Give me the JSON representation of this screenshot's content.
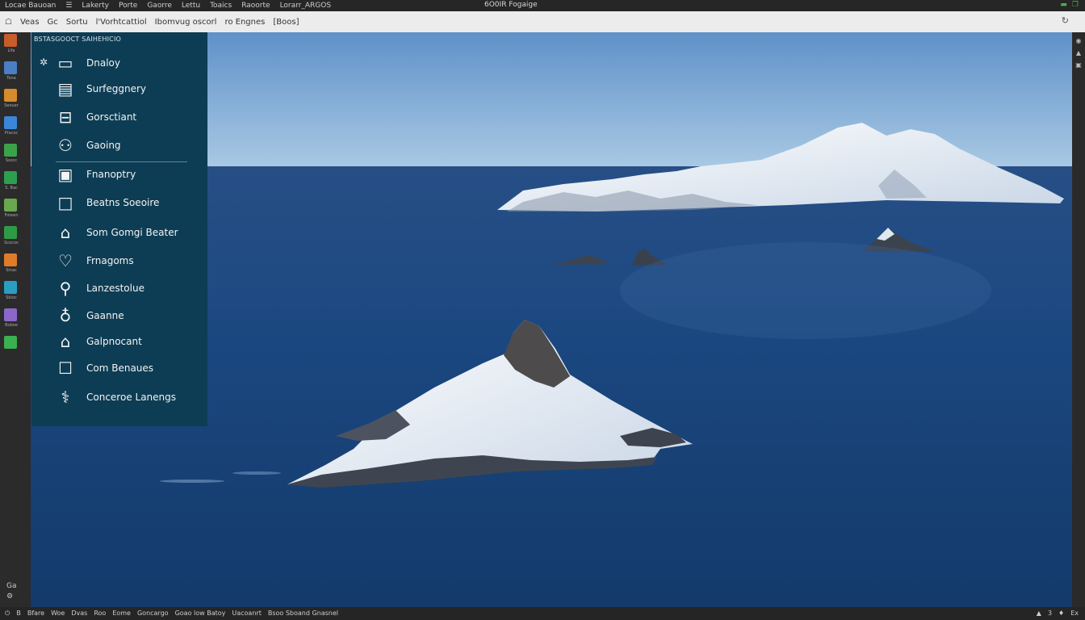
{
  "topbar": {
    "menu": [
      "Locae Bauoan",
      "☰",
      "Lakerty",
      "Porte",
      "Gaorre",
      "Lettu",
      "Toaics",
      "Raoorte",
      "Lorarr_ARGOS"
    ],
    "title": "6O0IR Fogaige",
    "right_icons": [
      "minimize-icon",
      "restore-icon"
    ]
  },
  "toolbar": {
    "items": [
      "☖",
      "Veas",
      "Gc",
      "Sortu",
      "l'Vorhtcattiol",
      "Ibomvug oscorl",
      "ro Engnes",
      "[Boos]"
    ],
    "right_icon": "refresh-icon"
  },
  "dock": {
    "labels": [
      "Lifa",
      "Tona",
      "Seouer",
      "Pracsc",
      "Ssocc",
      "S. Bac",
      "Foteen",
      "Scocov",
      "Sinac",
      "Sbioc",
      "Boboe"
    ],
    "colors": [
      "#c85c2a",
      "#4a7fc4",
      "#d68b2d",
      "#3a86d8",
      "#3aa34a",
      "#2e9e4f",
      "#6aa84f",
      "#2f9a46",
      "#e07b2a",
      "#2a9ec0",
      "#8c67c9",
      "#3ab04f"
    ],
    "bottom": [
      "Ga",
      "⚙"
    ]
  },
  "panel": {
    "title": "BSTASGOOCT SAIHEHICIO",
    "items": [
      {
        "label": "Dnaloy",
        "icon": "chat-bubble-icon"
      },
      {
        "label": "Surfeggnery",
        "icon": "document-stack-icon"
      },
      {
        "label": "Gorsctiant",
        "icon": "monitor-doc-icon"
      },
      {
        "label": "Gaoing",
        "icon": "gamepad-icon"
      },
      {
        "label": "Fnanoptry",
        "icon": "desktop-icon"
      },
      {
        "label": "Beatns Soeoire",
        "icon": "square-frame-icon"
      },
      {
        "label": "Som Gomgi Beater",
        "icon": "lock-frame-icon"
      },
      {
        "label": "Frnagoms",
        "icon": "heart-outline-icon"
      },
      {
        "label": "Lanzestolue",
        "icon": "location-pin-icon"
      },
      {
        "label": "Gaanne",
        "icon": "apple-outline-icon"
      },
      {
        "label": "Galpnocant",
        "icon": "house-outline-icon"
      },
      {
        "label": "Com Benaues",
        "icon": "square-outline-icon"
      },
      {
        "label": "Conceroe Lanengs",
        "icon": "stethoscope-icon"
      }
    ]
  },
  "statusbar": {
    "left": [
      "⏻",
      "B",
      "Bfare",
      "Woe",
      "Dvas",
      "Roo",
      "Eome",
      "Goncargo",
      "Goao low Batoy",
      "Uacoanrt",
      "Bsoo Sboand Gnasnel"
    ],
    "right": [
      "▲",
      "3",
      "♦",
      "Ex"
    ]
  }
}
